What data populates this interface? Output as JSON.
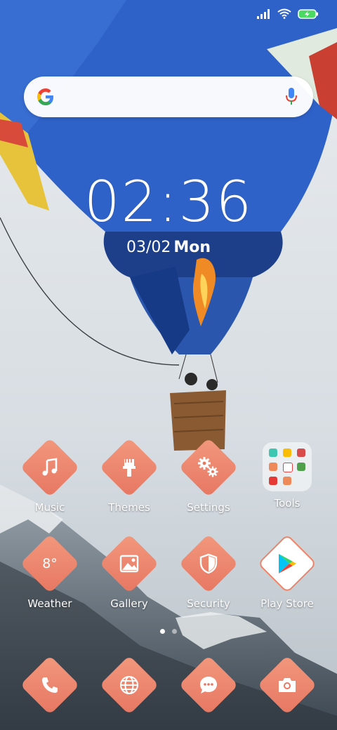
{
  "clock": {
    "time": "02:36",
    "date": "03/02",
    "day": "Mon"
  },
  "status": {
    "icons": [
      "signal-icon",
      "wifi-icon",
      "battery-charging-icon"
    ]
  },
  "search": {
    "logo": "google-g-icon",
    "mic": "mic-icon"
  },
  "apps_row1": [
    {
      "label": "Music",
      "icon": "music-note-icon"
    },
    {
      "label": "Themes",
      "icon": "brush-icon"
    },
    {
      "label": "Settings",
      "icon": "gear-icon"
    },
    {
      "label": "Tools",
      "icon": "folder-icon"
    }
  ],
  "apps_row2": [
    {
      "label": "Weather",
      "icon": "weather-icon",
      "temp": "8°"
    },
    {
      "label": "Gallery",
      "icon": "gallery-icon"
    },
    {
      "label": "Security",
      "icon": "shield-icon"
    },
    {
      "label": "Play Store",
      "icon": "play-store-icon"
    }
  ],
  "dock": [
    {
      "icon": "phone-icon"
    },
    {
      "icon": "browser-globe-icon"
    },
    {
      "icon": "messages-icon"
    },
    {
      "icon": "camera-icon"
    }
  ],
  "page_indicator": {
    "pages": 2,
    "current": 1
  },
  "colors": {
    "tile_accent": "#ec8469",
    "sky": "#d9dee3",
    "balloon_blue": "#2f62c9"
  }
}
